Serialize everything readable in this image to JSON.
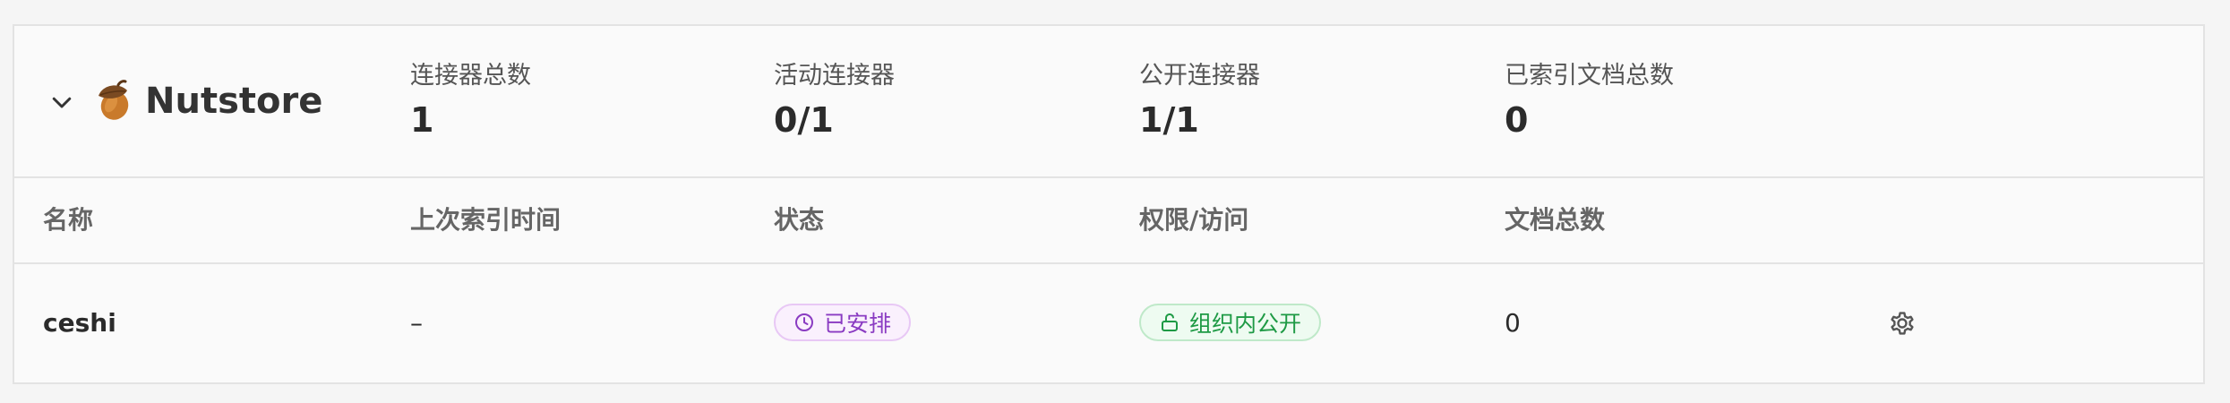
{
  "source": {
    "name": "Nutstore",
    "icon": "acorn-icon"
  },
  "stats": [
    {
      "label": "连接器总数",
      "value": "1"
    },
    {
      "label": "活动连接器",
      "value": "0/1"
    },
    {
      "label": "公开连接器",
      "value": "1/1"
    },
    {
      "label": "已索引文档总数",
      "value": "0"
    }
  ],
  "table": {
    "headers": {
      "name": "名称",
      "last_indexed": "上次索引时间",
      "status": "状态",
      "access": "权限/访问",
      "doc_count": "文档总数"
    },
    "rows": [
      {
        "name": "ceshi",
        "last_indexed": "–",
        "status": "已安排",
        "access": "组织内公开",
        "doc_count": "0"
      }
    ]
  },
  "colors": {
    "status_badge": "#8a3bc2",
    "access_badge": "#1e9a45"
  }
}
